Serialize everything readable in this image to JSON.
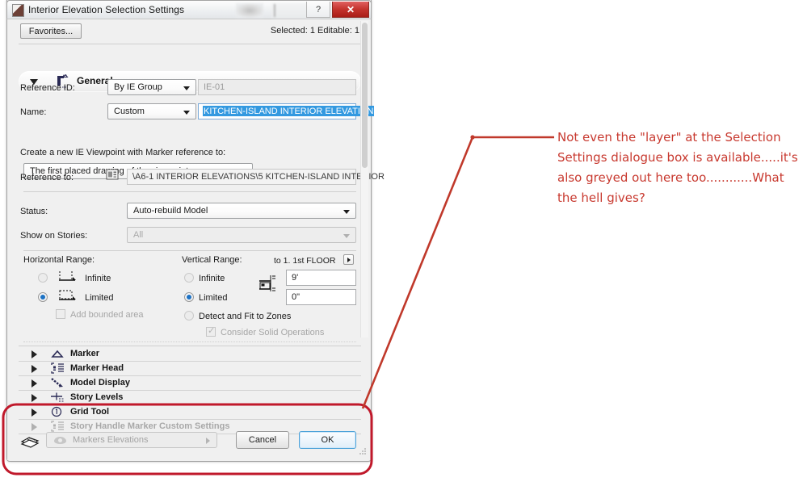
{
  "window": {
    "title": "Interior Elevation Selection Settings",
    "help_label": "?",
    "close_label": "✕"
  },
  "toolbar": {
    "favorites_label": "Favorites...",
    "selection_info": "Selected: 1 Editable: 1"
  },
  "general": {
    "section_title": "General",
    "reference_id": {
      "label": "Reference ID:",
      "mode": "By IE Group",
      "value": "IE-01"
    },
    "name": {
      "label": "Name:",
      "mode": "Custom",
      "value": "KITCHEN-ISLAND INTERIOR ELEVATION"
    },
    "viewpoint": {
      "label": "Create a new IE Viewpoint with Marker reference to:",
      "value": "The first placed drawing of the viewpoint"
    },
    "reference_to": {
      "label": "Reference to:",
      "value": "\\A6-1 INTERIOR ELEVATIONS\\5 KITCHEN-ISLAND INTERIOR"
    },
    "status": {
      "label": "Status:",
      "value": "Auto-rebuild Model"
    },
    "show_on_stories": {
      "label": "Show on Stories:",
      "value": "All"
    }
  },
  "ranges": {
    "horizontal": {
      "label": "Horizontal Range:",
      "infinite_label": "Infinite",
      "limited_label": "Limited",
      "bounded_label": "Add bounded area",
      "selected": "Limited"
    },
    "vertical": {
      "label": "Vertical Range:",
      "story_label": "to 1. 1st FLOOR",
      "infinite_label": "Infinite",
      "limited_label": "Limited",
      "detect_label": "Detect and Fit to Zones",
      "solid_label": "Consider Solid Operations",
      "selected": "Limited",
      "top_value": "9'",
      "bottom_value": "0\""
    }
  },
  "sections": [
    {
      "label": "Marker",
      "icon": "triangle-marker-icon",
      "disabled": false
    },
    {
      "label": "Marker Head",
      "icon": "marker-head-icon",
      "disabled": false
    },
    {
      "label": "Model Display",
      "icon": "model-display-icon",
      "disabled": false
    },
    {
      "label": "Story Levels",
      "icon": "story-levels-icon",
      "disabled": false
    },
    {
      "label": "Grid Tool",
      "icon": "grid-tool-icon",
      "disabled": false
    },
    {
      "label": "Story Handle Marker Custom Settings",
      "icon": "marker-head-icon",
      "disabled": true
    }
  ],
  "footer": {
    "layer_label": "Markers Elevations",
    "cancel_label": "Cancel",
    "ok_label": "OK"
  },
  "annotation": {
    "text": "Not even the \"layer\" at the Selection Settings dialogue box is available.....it's also greyed out here too............What the hell gives?",
    "color": "#c8392f",
    "highlight_color": "#c0192b"
  }
}
